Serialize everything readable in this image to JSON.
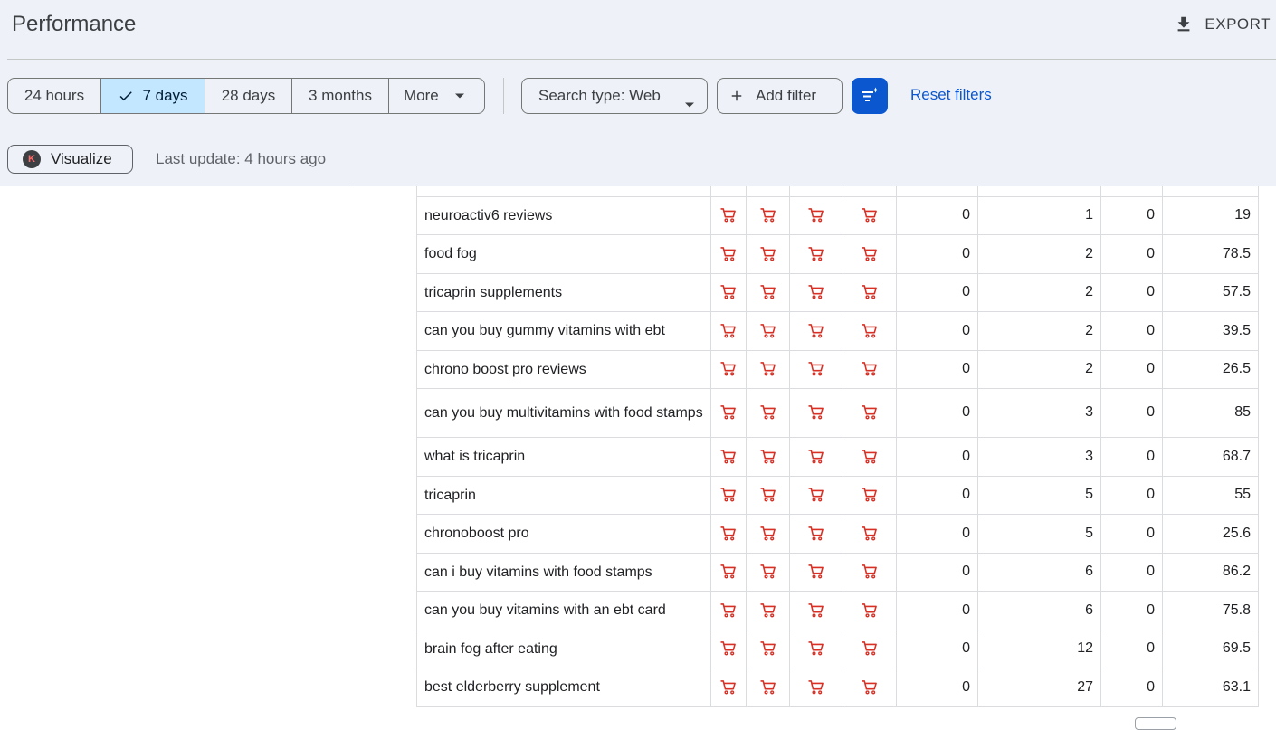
{
  "header": {
    "title": "Performance",
    "export_label": "EXPORT"
  },
  "date_range": {
    "options": [
      {
        "label": "24 hours",
        "active": false
      },
      {
        "label": "7 days",
        "active": true
      },
      {
        "label": "28 days",
        "active": false
      },
      {
        "label": "3 months",
        "active": false
      },
      {
        "label": "More",
        "active": false
      }
    ]
  },
  "filters": {
    "search_type_label": "Search type: Web",
    "add_filter_label": "Add filter",
    "reset_label": "Reset filters"
  },
  "toolbar2": {
    "visualize_label": "Visualize",
    "visualize_badge": "K",
    "last_update": "Last update: 4 hours ago"
  },
  "colors": {
    "accent": "#0b57d0",
    "active_segment": "#c2e7ff",
    "header_bg": "#eef2f8",
    "cart_icon": "#d93025"
  },
  "table": {
    "icon_columns": [
      "shopping-cart-icon",
      "shopping-cart-icon",
      "shopping-cart-icon",
      "shopping-cart-icon"
    ],
    "rows": [
      {
        "query": "neuroactiv6 reviews",
        "c1": "0",
        "c2": "1",
        "c3": "0",
        "c4": "19"
      },
      {
        "query": "food fog",
        "c1": "0",
        "c2": "2",
        "c3": "0",
        "c4": "78.5"
      },
      {
        "query": "tricaprin supplements",
        "c1": "0",
        "c2": "2",
        "c3": "0",
        "c4": "57.5"
      },
      {
        "query": "can you buy gummy vitamins with ebt",
        "c1": "0",
        "c2": "2",
        "c3": "0",
        "c4": "39.5"
      },
      {
        "query": "chrono boost pro reviews",
        "c1": "0",
        "c2": "2",
        "c3": "0",
        "c4": "26.5"
      },
      {
        "query": "can you buy multivitamins with food stamps",
        "c1": "0",
        "c2": "3",
        "c3": "0",
        "c4": "85"
      },
      {
        "query": "what is tricaprin",
        "c1": "0",
        "c2": "3",
        "c3": "0",
        "c4": "68.7"
      },
      {
        "query": "tricaprin",
        "c1": "0",
        "c2": "5",
        "c3": "0",
        "c4": "55"
      },
      {
        "query": "chronoboost pro",
        "c1": "0",
        "c2": "5",
        "c3": "0",
        "c4": "25.6"
      },
      {
        "query": "can i buy vitamins with food stamps",
        "c1": "0",
        "c2": "6",
        "c3": "0",
        "c4": "86.2"
      },
      {
        "query": "can you buy vitamins with an ebt card",
        "c1": "0",
        "c2": "6",
        "c3": "0",
        "c4": "75.8"
      },
      {
        "query": "brain fog after eating",
        "c1": "0",
        "c2": "12",
        "c3": "0",
        "c4": "69.5"
      },
      {
        "query": "best elderberry supplement",
        "c1": "0",
        "c2": "27",
        "c3": "0",
        "c4": "63.1"
      }
    ]
  }
}
